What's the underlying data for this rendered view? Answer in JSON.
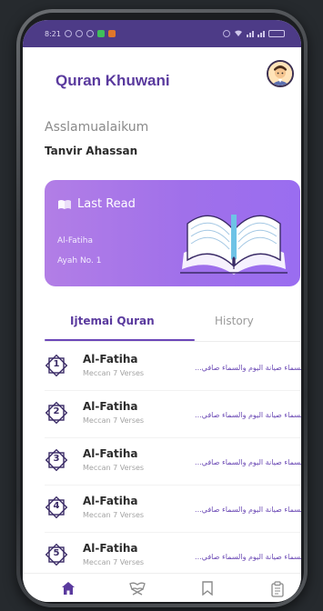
{
  "status_bar": {
    "time": "8:21"
  },
  "header": {
    "title": "Quran Khuwani"
  },
  "greeting": "Asslamualaikum",
  "user_name": "Tanvir Ahassan",
  "last_read": {
    "label": "Last Read",
    "surah": "Al-Fatiha",
    "ayah": "Ayah No. 1"
  },
  "tabs": [
    {
      "label": "Ijtemai Quran",
      "active": true
    },
    {
      "label": "History",
      "active": false
    }
  ],
  "surahs": [
    {
      "number": "1",
      "name": "Al-Fatiha",
      "details": "Meccan 7 Verses",
      "arabic": "السماء صيانة اليوم والسماء صافي..."
    },
    {
      "number": "2",
      "name": "Al-Fatiha",
      "details": "Meccan 7 Verses",
      "arabic": "السماء صيانة اليوم والسماء صافي..."
    },
    {
      "number": "3",
      "name": "Al-Fatiha",
      "details": "Meccan 7 Verses",
      "arabic": "السماء صيانة اليوم والسماء صافي..."
    },
    {
      "number": "4",
      "name": "Al-Fatiha",
      "details": "Meccan 7 Verses",
      "arabic": "السماء صيانة اليوم والسماء صافي..."
    },
    {
      "number": "5",
      "name": "Al-Fatiha",
      "details": "Meccan 7 Verses",
      "arabic": "السماء صيانة اليوم والسماء صافي..."
    }
  ],
  "bottom_nav": [
    {
      "icon": "home-icon",
      "active": true
    },
    {
      "icon": "quran-stand-icon",
      "active": false
    },
    {
      "icon": "bookmark-icon",
      "active": false
    },
    {
      "icon": "history-clipboard-icon",
      "active": false
    }
  ],
  "colors": {
    "brand": "#5a3a9e",
    "card_gradient_start": "#b27ee6",
    "card_gradient_end": "#9a6df0",
    "status_bar": "#4d3b87"
  }
}
